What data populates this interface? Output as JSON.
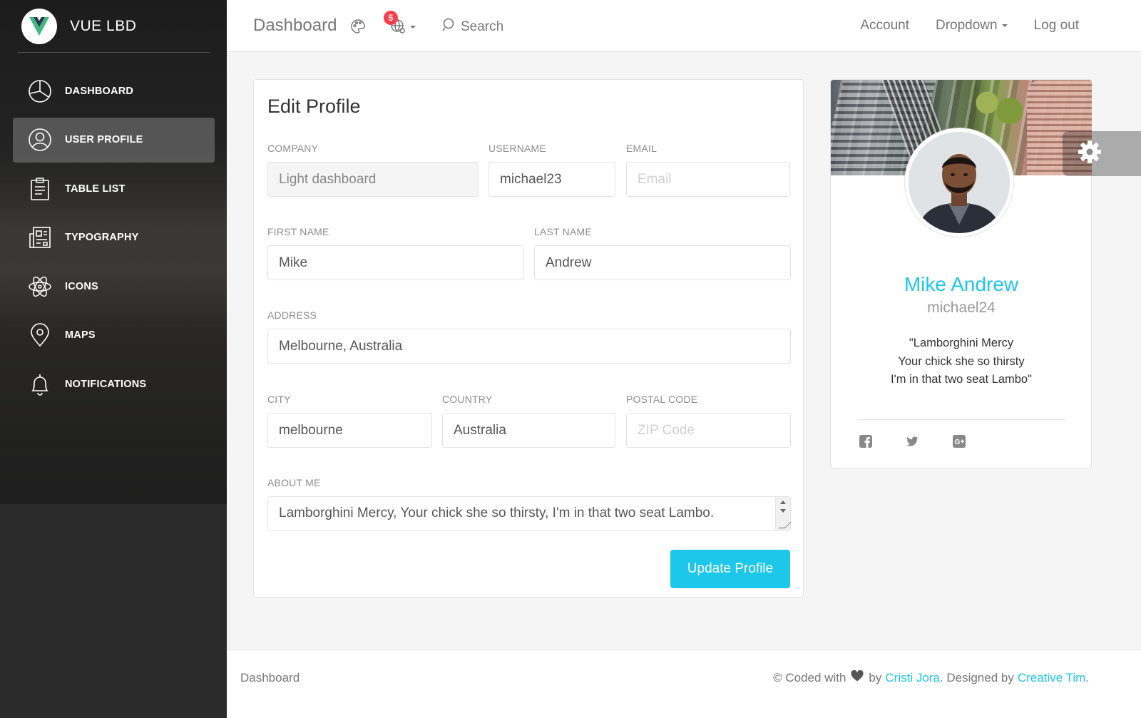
{
  "sidebar": {
    "logo_text": "VUE LBD",
    "items": [
      {
        "label": "DASHBOARD",
        "icon": "pie-chart-icon"
      },
      {
        "label": "USER PROFILE",
        "icon": "user-circle-icon"
      },
      {
        "label": "TABLE LIST",
        "icon": "clipboard-icon"
      },
      {
        "label": "TYPOGRAPHY",
        "icon": "news-icon"
      },
      {
        "label": "ICONS",
        "icon": "atom-icon"
      },
      {
        "label": "MAPS",
        "icon": "map-pin-icon"
      },
      {
        "label": "NOTIFICATIONS",
        "icon": "bell-icon"
      }
    ],
    "active_index": 1
  },
  "topbar": {
    "brand": "Dashboard",
    "notification_count": "5",
    "search_label": "Search",
    "links": {
      "account": "Account",
      "dropdown": "Dropdown",
      "logout": "Log out"
    }
  },
  "edit_profile": {
    "title": "Edit Profile",
    "company": {
      "label": "COMPANY",
      "value": "Light dashboard"
    },
    "username": {
      "label": "USERNAME",
      "value": "michael23"
    },
    "email": {
      "label": "EMAIL",
      "value": "",
      "placeholder": "Email"
    },
    "first_name": {
      "label": "FIRST NAME",
      "value": "Mike"
    },
    "last_name": {
      "label": "LAST NAME",
      "value": "Andrew"
    },
    "address": {
      "label": "ADDRESS",
      "value": "Melbourne, Australia"
    },
    "city": {
      "label": "CITY",
      "value": "melbourne"
    },
    "country": {
      "label": "COUNTRY",
      "value": "Australia"
    },
    "postal_code": {
      "label": "POSTAL CODE",
      "value": "",
      "placeholder": "ZIP Code"
    },
    "about": {
      "label": "ABOUT ME",
      "value": "Lamborghini Mercy, Your chick she so thirsty, I'm in that two seat Lambo."
    },
    "submit_label": "Update Profile"
  },
  "user_card": {
    "name": "Mike Andrew",
    "handle": "michael24",
    "quote_lines": [
      "\"Lamborghini Mercy",
      "Your chick she so thirsty",
      "I'm in that two seat Lambo\""
    ],
    "social": [
      "facebook-icon",
      "twitter-icon",
      "google-plus-icon"
    ]
  },
  "footer": {
    "left": "Dashboard",
    "coded_with": "© Coded with",
    "by": "by",
    "author": "Cristi Jora",
    "designed_by": ". Designed by",
    "designer": "Creative Tim",
    "end": "."
  },
  "colors": {
    "accent": "#1dc7ea",
    "badge": "#fb404b",
    "sidebar": "#2b2b2b"
  }
}
